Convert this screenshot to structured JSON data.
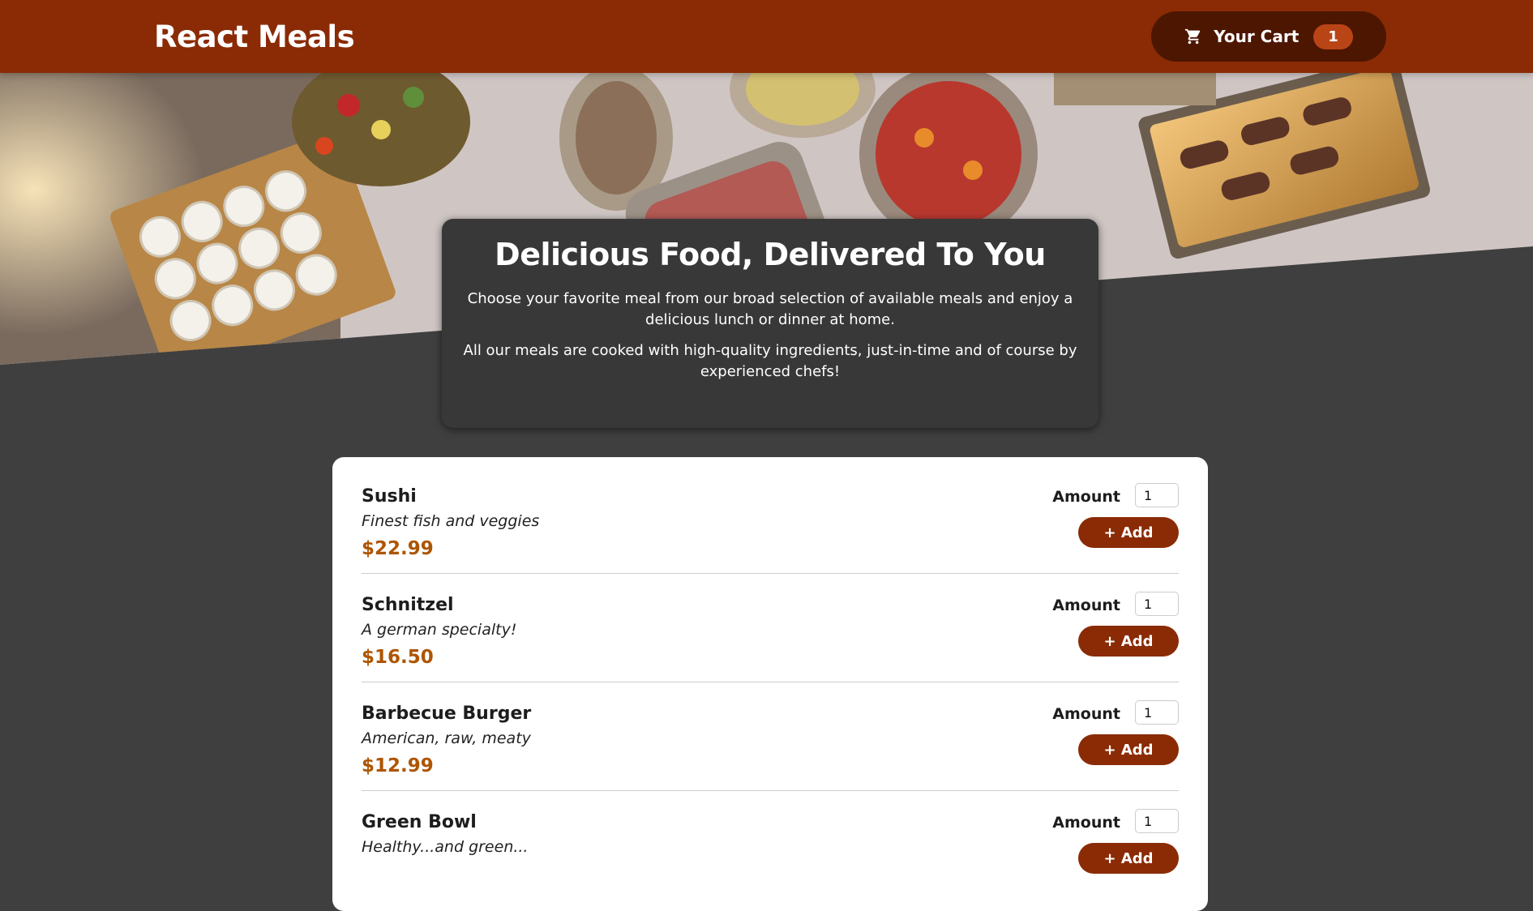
{
  "header": {
    "title": "React Meals",
    "cart": {
      "label": "Your Cart",
      "count": "1",
      "icon": "cart-icon"
    }
  },
  "hero": {
    "image": "buffet-table-photo"
  },
  "summary": {
    "heading": "Delicious Food, Delivered To You",
    "paragraph1": "Choose your favorite meal from our broad selection of available meals and enjoy a delicious lunch or dinner at home.",
    "paragraph2": "All our meals are cooked with high-quality ingredients, just-in-time and of course by experienced chefs!"
  },
  "meals": {
    "amount_label": "Amount",
    "add_label": "+ Add",
    "items": [
      {
        "name": "Sushi",
        "description": "Finest fish and veggies",
        "price": "$22.99",
        "amount": "1"
      },
      {
        "name": "Schnitzel",
        "description": "A german specialty!",
        "price": "$16.50",
        "amount": "1"
      },
      {
        "name": "Barbecue Burger",
        "description": "American, raw, meaty",
        "price": "$12.99",
        "amount": "1"
      },
      {
        "name": "Green Bowl",
        "description": "Healthy...and green...",
        "price": "",
        "amount": "1"
      }
    ]
  },
  "colors": {
    "header": "#8a2b06",
    "cart_button": "#4d1601",
    "badge": "#b94517",
    "price": "#ad5502",
    "background": "#3f3f3f",
    "summary_card": "#383838"
  }
}
